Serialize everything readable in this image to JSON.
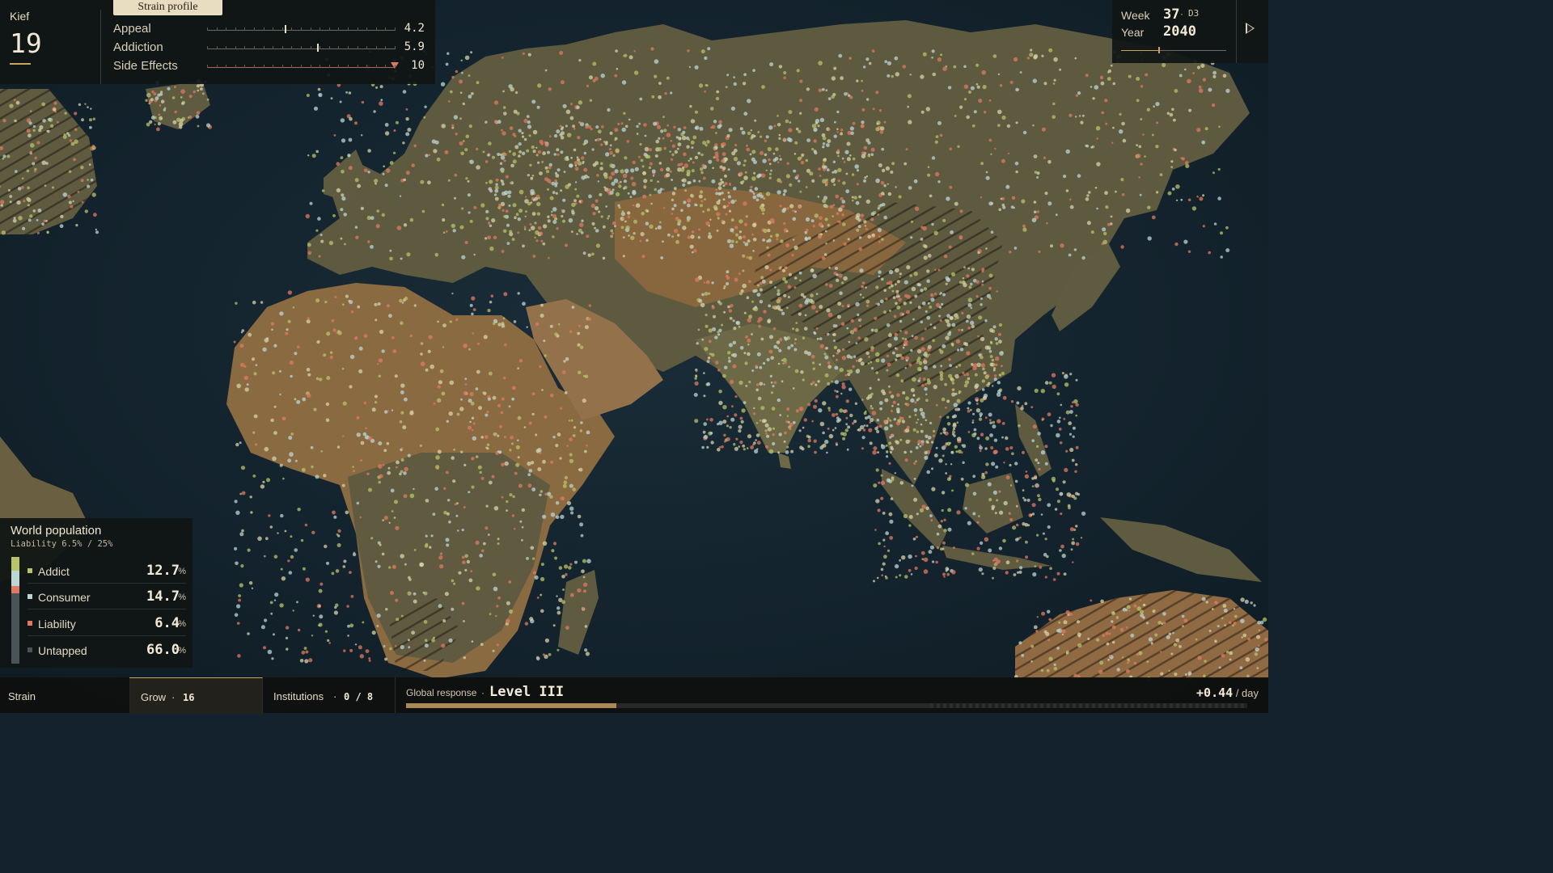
{
  "strain": {
    "name": "Kief",
    "level": "19",
    "profile_tab": "Strain profile",
    "stats": [
      {
        "label": "Appeal",
        "value": "4.2",
        "fraction": 0.42
      },
      {
        "label": "Addiction",
        "value": "5.9",
        "fraction": 0.59
      },
      {
        "label": "Side Effects",
        "value": "10",
        "fraction": 1.0
      }
    ]
  },
  "time": {
    "week_label": "Week",
    "week": "37",
    "day": "D3",
    "year_label": "Year",
    "year": "2040",
    "progress": 0.35
  },
  "population": {
    "title": "World population",
    "subtitle": "Liability 6.5% / 25%",
    "rows": [
      {
        "label": "Addict",
        "value": "12.7",
        "unit": "%",
        "color": "#b8c36a"
      },
      {
        "label": "Consumer",
        "value": "14.7",
        "unit": "%",
        "color": "#bcd6d6"
      },
      {
        "label": "Liability",
        "value": "6.4",
        "unit": "%",
        "color": "#e07a62"
      },
      {
        "label": "Untapped",
        "value": "66.0",
        "unit": "%",
        "color": "#4a5458"
      }
    ]
  },
  "bottom": {
    "tabs": [
      {
        "label": "Strain",
        "value": ""
      },
      {
        "label": "Grow",
        "sep": "·",
        "value": "16"
      },
      {
        "label": "Institutions",
        "sep": "·",
        "value": "0 / 8"
      }
    ],
    "response_label": "Global response",
    "response_sep": "·",
    "response_level": "Level III",
    "response_progress": 0.25,
    "rate_value": "+0.44",
    "rate_unit": "/ day"
  },
  "colors": {
    "ocean": "#13222d",
    "land": "#5e5a40",
    "desert": "#9a6f42",
    "accent": "#c9a45e",
    "addict": "#b8c36a",
    "consumer": "#bcd6d6",
    "liability": "#e07a62"
  }
}
